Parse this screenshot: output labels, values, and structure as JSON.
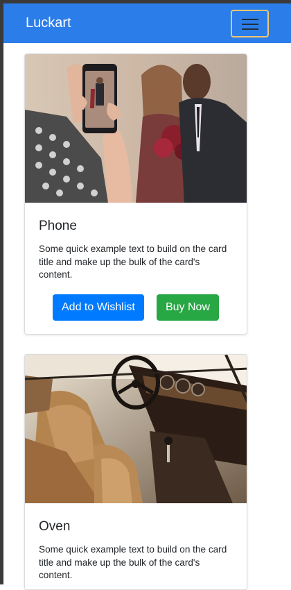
{
  "navbar": {
    "brand": "Luckart",
    "toggler_icon": "hamburger-menu-icon"
  },
  "cards": [
    {
      "image_description_icon": "phone-photo-image",
      "title": "Phone",
      "text": "Some quick example text to build on the card title and make up the bulk of the card's content.",
      "wishlist_label": "Add to Wishlist",
      "buy_label": "Buy Now"
    },
    {
      "image_description_icon": "car-interior-image",
      "title": "Oven",
      "text": "Some quick example text to build on the card title and make up the bulk of the card's content."
    }
  ],
  "colors": {
    "navbar": "#2b7de9",
    "primary": "#007bff",
    "success": "#28a745",
    "toggler_border": "#f0c674"
  }
}
